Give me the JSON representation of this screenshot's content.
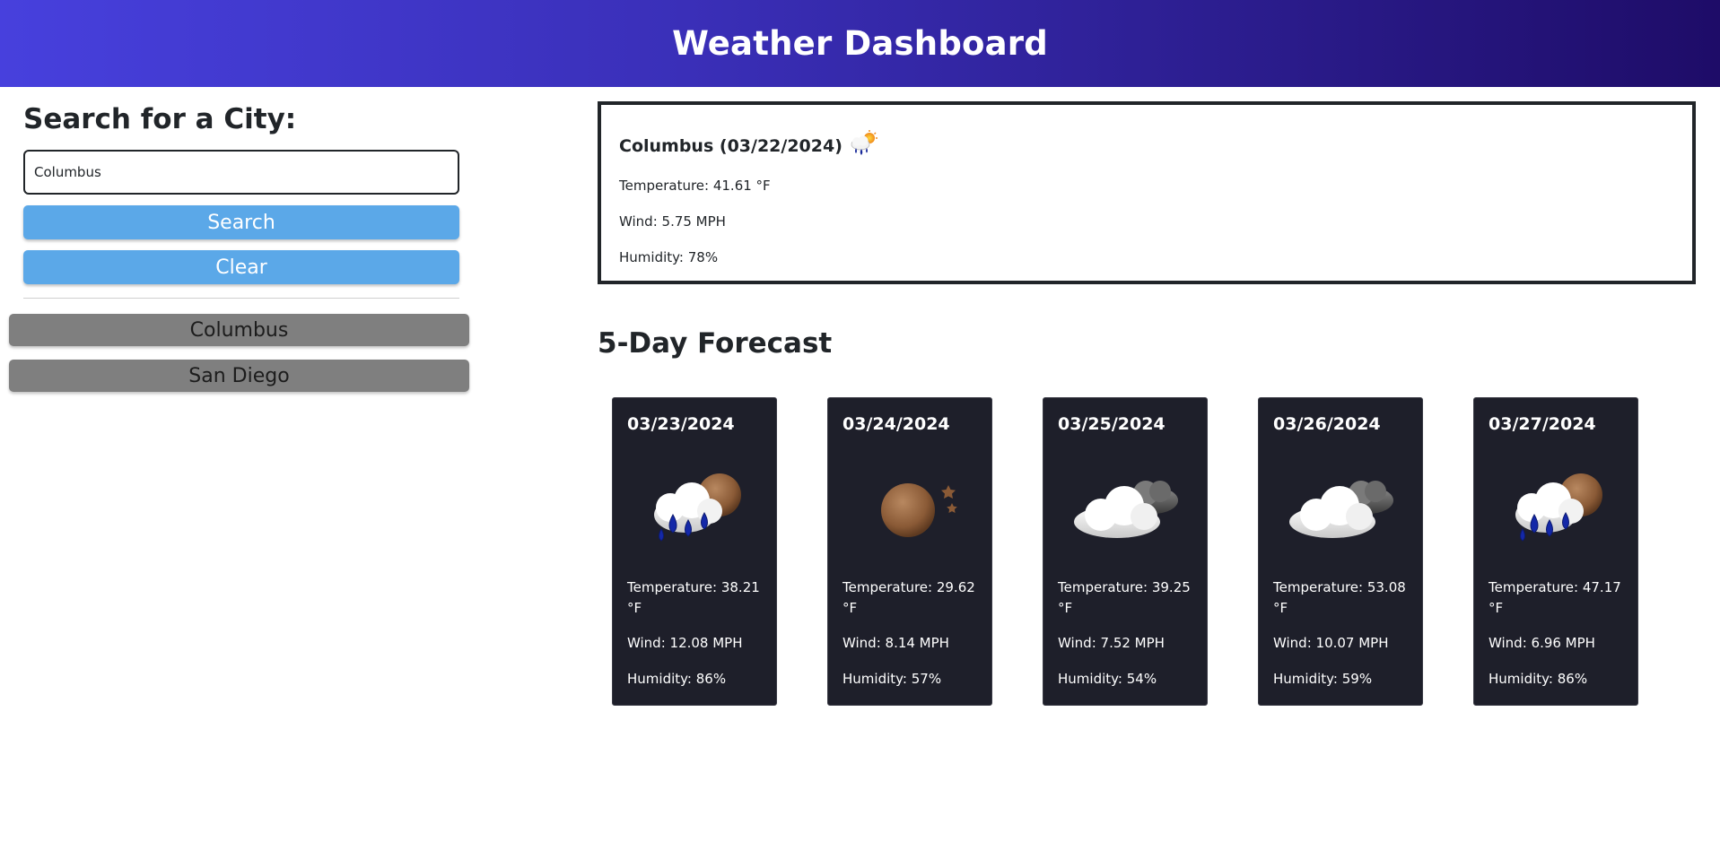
{
  "header": {
    "title": "Weather Dashboard"
  },
  "sidebar": {
    "search_title": "Search for a City:",
    "input_value": "Columbus",
    "search_label": "Search",
    "clear_label": "Clear",
    "history": [
      "Columbus",
      "San Diego"
    ]
  },
  "current": {
    "title": "Columbus (03/22/2024)",
    "icon": "rain-cloud-sun-icon",
    "temperature": "Temperature: 41.61 °F",
    "wind": "Wind: 5.75 MPH",
    "humidity": "Humidity: 78%"
  },
  "forecast_title": "5-Day Forecast",
  "forecast": [
    {
      "date": "03/23/2024",
      "icon": "rain-cloud-moon-icon",
      "temperature": "Temperature: 38.21 °F",
      "wind": "Wind: 12.08 MPH",
      "humidity": "Humidity: 86%"
    },
    {
      "date": "03/24/2024",
      "icon": "clear-night-moon-icon",
      "temperature": "Temperature: 29.62 °F",
      "wind": "Wind: 8.14 MPH",
      "humidity": "Humidity: 57%"
    },
    {
      "date": "03/25/2024",
      "icon": "broken-clouds-icon",
      "temperature": "Temperature: 39.25 °F",
      "wind": "Wind: 7.52 MPH",
      "humidity": "Humidity: 54%"
    },
    {
      "date": "03/26/2024",
      "icon": "broken-clouds-icon",
      "temperature": "Temperature: 53.08 °F",
      "wind": "Wind: 10.07 MPH",
      "humidity": "Humidity: 59%"
    },
    {
      "date": "03/27/2024",
      "icon": "rain-cloud-moon-icon",
      "temperature": "Temperature: 47.17 °F",
      "wind": "Wind: 6.96 MPH",
      "humidity": "Humidity: 86%"
    }
  ],
  "colors": {
    "header_start": "#4740dd",
    "header_end": "#1e0c68",
    "button_blue": "#5ba8e8",
    "button_gray": "#7f7f7f",
    "card_bg": "#1e1f2a"
  }
}
